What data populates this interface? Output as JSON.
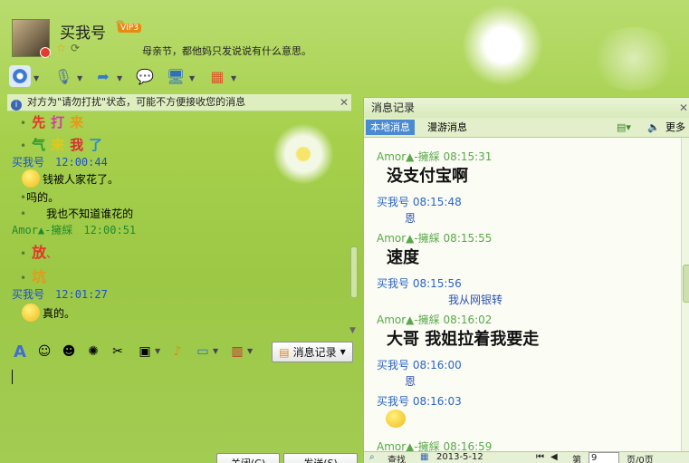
{
  "header": {
    "nickname": "买我号",
    "vip_badge": "VIP3",
    "signature": "母亲节，都他妈只发说说有什么意思。"
  },
  "notice": "对方为\"请勿打扰\"状态，可能不方便接收您的消息",
  "chat": [
    {
      "type": "colored",
      "chars": [
        {
          "t": "先",
          "c": "#e8302a"
        },
        {
          "t": "打",
          "c": "#d43aa8"
        },
        {
          "t": "来",
          "c": "#e39a1a"
        }
      ]
    },
    {
      "type": "colored",
      "chars": [
        {
          "t": "气",
          "c": "#2d9a2d"
        },
        {
          "t": "来",
          "c": "#e2c81a"
        },
        {
          "t": "我",
          "c": "#d62e2e"
        },
        {
          "t": "了",
          "c": "#2a8bd4"
        }
      ]
    },
    {
      "type": "header",
      "sender": "买我号",
      "time": "12:00:44",
      "color": "#1b4fd0"
    },
    {
      "type": "emoji_text",
      "text": "钱被人家花了。"
    },
    {
      "type": "text",
      "text": "吗的。"
    },
    {
      "type": "text",
      "text": "我也不知道谁花的"
    },
    {
      "type": "header",
      "sender": "Amor▲-擁綵",
      "time": "12:00:51",
      "color": "#1f8a2c"
    },
    {
      "type": "big",
      "text": "放",
      "color": "#e8302a",
      "suffix": "、"
    },
    {
      "type": "big",
      "text": "坑",
      "color": "#e39a1a",
      "suffix": ""
    },
    {
      "type": "header",
      "sender": "买我号",
      "time": "12:01:27",
      "color": "#1b4fd0"
    },
    {
      "type": "emoji_text",
      "text": "真的。"
    }
  ],
  "buttons": {
    "history": "消息记录",
    "close": "关闭(C)",
    "send": "发送(S)"
  },
  "history": {
    "title": "消息记录",
    "tab_local": "本地消息",
    "tab_roam": "漫游消息",
    "more": "更多",
    "entries": [
      {
        "sender": "Amor▲-擁綵",
        "time": "08:15:31",
        "text": "没支付宝啊",
        "big": true,
        "color": "#5aa84a"
      },
      {
        "sender": "买我号",
        "time": "08:15:48",
        "text": "恩",
        "big": false,
        "color": "#2b63c9"
      },
      {
        "sender": "Amor▲-擁綵",
        "time": "08:15:55",
        "text": "速度",
        "big": true,
        "color": "#5aa84a"
      },
      {
        "sender": "买我号",
        "time": "08:15:56",
        "text": "我从网银转",
        "big": false,
        "color": "#2b63c9"
      },
      {
        "sender": "Amor▲-擁綵",
        "time": "08:16:02",
        "text": "大哥 我姐拉着我要走",
        "big": true,
        "color": "#5aa84a"
      },
      {
        "sender": "买我号",
        "time": "08:16:00",
        "text": "恩",
        "big": false,
        "color": "#2b63c9"
      },
      {
        "sender": "买我号",
        "time": "08:16:03",
        "text": "",
        "big": false,
        "color": "#2b63c9",
        "emoji": true
      },
      {
        "sender": "Amor▲-擁綵",
        "time": "08:16:59",
        "text": "",
        "big": false,
        "color": "#5aa84a"
      }
    ],
    "footer": {
      "search": "查找",
      "date": "2013-5-12",
      "page_label": "第",
      "page_value": "9",
      "page_total": "页/0页"
    }
  }
}
